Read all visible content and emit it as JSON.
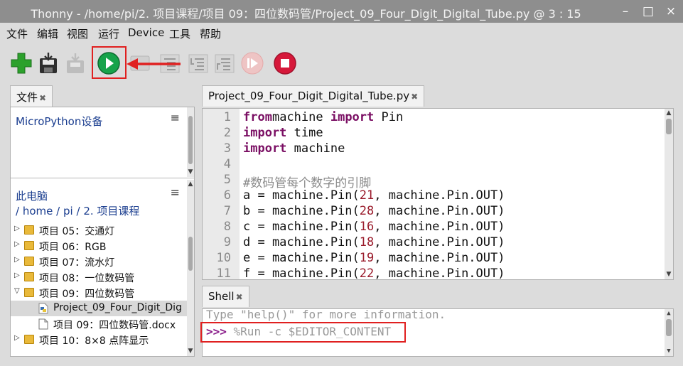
{
  "window": {
    "title": "Thonny  -  /home/pi/2. 项目课程/项目 09：四位数码管/Project_09_Four_Digit_Digital_Tube.py  @  3 : 15",
    "controls": {
      "minimize": "–",
      "maximize": "□",
      "close": "×"
    }
  },
  "menu": [
    "文件",
    "编辑",
    "视图",
    "运行",
    "Device",
    "工具",
    "帮助"
  ],
  "toolbar": {
    "icons": [
      "new-icon",
      "save-icon",
      "load-icon",
      "run-icon",
      "debug-icon",
      "step-over-icon",
      "step-into-icon",
      "step-out-icon",
      "resume-icon",
      "stop-icon"
    ],
    "colors": {
      "new": "#2ca12c",
      "run": "#16a34a",
      "stop": "#d6183a",
      "highlight": "#e02020"
    }
  },
  "files_panel": {
    "tab_label": "文件",
    "device_section": "MicroPython设备",
    "computer_section": "此电脑",
    "breadcrumb": {
      "root": "/",
      "p1": "home",
      "sep1": "/",
      "p2": "pi",
      "sep2": "/",
      "p3": "2. 项目课程"
    },
    "items": [
      {
        "label": "项目 05：交通灯",
        "type": "folder",
        "expander": "▷"
      },
      {
        "label": "项目 06：RGB",
        "type": "folder",
        "expander": "▷"
      },
      {
        "label": "项目 07：流水灯",
        "type": "folder",
        "expander": "▷"
      },
      {
        "label": "项目 08：一位数码管",
        "type": "folder",
        "expander": "▷"
      },
      {
        "label": "项目 09：四位数码管",
        "type": "folder",
        "expander": "▽"
      },
      {
        "label": "Project_09_Four_Digit_Dig",
        "type": "python",
        "expander": ""
      },
      {
        "label": "项目 09：四位数码管.docx",
        "type": "file",
        "expander": ""
      },
      {
        "label": "项目 10：8×8 点阵显示",
        "type": "folder",
        "expander": "▷"
      }
    ]
  },
  "editor": {
    "tab_label": "Project_09_Four_Digit_Digital_Tube.py",
    "lines": [
      {
        "n": "1",
        "parts": [
          [
            "kw",
            "from"
          ],
          [
            "",
            "machine "
          ],
          [
            "kw",
            "import"
          ],
          [
            "",
            " Pin"
          ]
        ]
      },
      {
        "n": "2",
        "parts": [
          [
            "kw",
            "import"
          ],
          [
            "",
            " time"
          ]
        ]
      },
      {
        "n": "3",
        "parts": [
          [
            "kw",
            "import"
          ],
          [
            "",
            " machine"
          ]
        ]
      },
      {
        "n": "4",
        "parts": []
      },
      {
        "n": "5",
        "parts": [
          [
            "cmt",
            "#数码管每个数字的引脚"
          ]
        ]
      },
      {
        "n": "6",
        "parts": [
          [
            "",
            "a = machine.Pin("
          ],
          [
            "num",
            "21"
          ],
          [
            "",
            ", machine.Pin.OUT)"
          ]
        ]
      },
      {
        "n": "7",
        "parts": [
          [
            "",
            "b = machine.Pin("
          ],
          [
            "num",
            "28"
          ],
          [
            "",
            ", machine.Pin.OUT)"
          ]
        ]
      },
      {
        "n": "8",
        "parts": [
          [
            "",
            "c = machine.Pin("
          ],
          [
            "num",
            "16"
          ],
          [
            "",
            ", machine.Pin.OUT)"
          ]
        ]
      },
      {
        "n": "9",
        "parts": [
          [
            "",
            "d = machine.Pin("
          ],
          [
            "num",
            "18"
          ],
          [
            "",
            ", machine.Pin.OUT)"
          ]
        ]
      },
      {
        "n": "10",
        "parts": [
          [
            "",
            "e = machine.Pin("
          ],
          [
            "num",
            "19"
          ],
          [
            "",
            ", machine.Pin.OUT)"
          ]
        ]
      },
      {
        "n": "11",
        "parts": [
          [
            "",
            "f = machine.Pin("
          ],
          [
            "num",
            "22"
          ],
          [
            "",
            ", machine.Pin.OUT)"
          ]
        ]
      }
    ]
  },
  "shell": {
    "tab_label": "Shell",
    "help_text": "Type \"help()\" for more information.",
    "prompt": ">>>",
    "command": " %Run -c $EDITOR_CONTENT"
  }
}
